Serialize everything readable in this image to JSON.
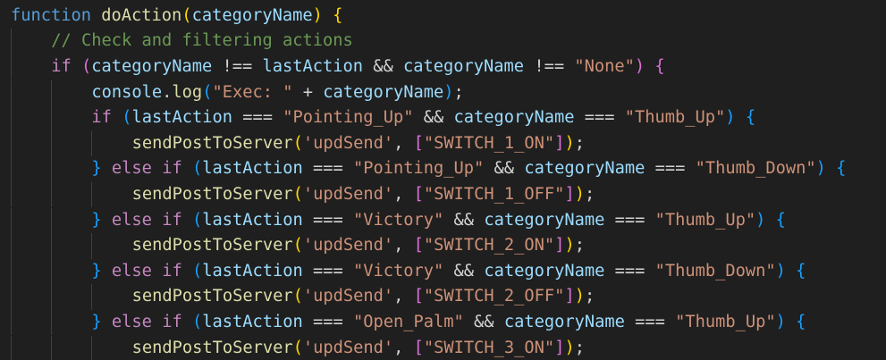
{
  "editor": {
    "colors": {
      "background": "#1f1f1f",
      "keyword": "#569cd6",
      "function": "#dcdcaa",
      "variable": "#9cdcfe",
      "comment": "#6a9955",
      "control": "#c586c0",
      "string": "#ce9178"
    },
    "lines": [
      {
        "indent": 0,
        "tokens": [
          [
            "function",
            "kw"
          ],
          [
            " ",
            "op"
          ],
          [
            "doAction",
            "fn"
          ],
          [
            "(",
            "b1"
          ],
          [
            "categoryName",
            "var"
          ],
          [
            ")",
            "b1"
          ],
          [
            " ",
            "op"
          ],
          [
            "{",
            "b1"
          ]
        ]
      },
      {
        "indent": 1,
        "tokens": [
          [
            "// Check and filtering actions",
            "cm"
          ]
        ]
      },
      {
        "indent": 1,
        "tokens": [
          [
            "if",
            "ctl"
          ],
          [
            " ",
            "op"
          ],
          [
            "(",
            "b2"
          ],
          [
            "categoryName",
            "var"
          ],
          [
            " !== ",
            "op"
          ],
          [
            "lastAction",
            "var"
          ],
          [
            " && ",
            "op"
          ],
          [
            "categoryName",
            "var"
          ],
          [
            " !== ",
            "op"
          ],
          [
            "\"None\"",
            "str"
          ],
          [
            ")",
            "b2"
          ],
          [
            " ",
            "op"
          ],
          [
            "{",
            "b2"
          ]
        ]
      },
      {
        "indent": 2,
        "tokens": [
          [
            "console",
            "var"
          ],
          [
            ".",
            "op"
          ],
          [
            "log",
            "fn"
          ],
          [
            "(",
            "b3"
          ],
          [
            "\"Exec: \"",
            "str"
          ],
          [
            " + ",
            "op"
          ],
          [
            "categoryName",
            "var"
          ],
          [
            ")",
            "b3"
          ],
          [
            ";",
            "op"
          ]
        ]
      },
      {
        "indent": 2,
        "tokens": [
          [
            "if",
            "ctl"
          ],
          [
            " ",
            "op"
          ],
          [
            "(",
            "b3"
          ],
          [
            "lastAction",
            "var"
          ],
          [
            " === ",
            "op"
          ],
          [
            "\"Pointing_Up\"",
            "str"
          ],
          [
            " && ",
            "op"
          ],
          [
            "categoryName",
            "var"
          ],
          [
            " === ",
            "op"
          ],
          [
            "\"Thumb_Up\"",
            "str"
          ],
          [
            ")",
            "b3"
          ],
          [
            " ",
            "op"
          ],
          [
            "{",
            "b3"
          ]
        ]
      },
      {
        "indent": 3,
        "tokens": [
          [
            "sendPostToServer",
            "fn"
          ],
          [
            "(",
            "b1"
          ],
          [
            "'updSend'",
            "str"
          ],
          [
            ", ",
            "op"
          ],
          [
            "[",
            "b2"
          ],
          [
            "\"SWITCH_1_ON\"",
            "str"
          ],
          [
            "]",
            "b2"
          ],
          [
            ")",
            "b1"
          ],
          [
            ";",
            "op"
          ]
        ]
      },
      {
        "indent": 2,
        "tokens": [
          [
            "}",
            "b3"
          ],
          [
            " ",
            "op"
          ],
          [
            "else",
            "ctl"
          ],
          [
            " ",
            "op"
          ],
          [
            "if",
            "ctl"
          ],
          [
            " ",
            "op"
          ],
          [
            "(",
            "b3"
          ],
          [
            "lastAction",
            "var"
          ],
          [
            " === ",
            "op"
          ],
          [
            "\"Pointing_Up\"",
            "str"
          ],
          [
            " && ",
            "op"
          ],
          [
            "categoryName",
            "var"
          ],
          [
            " === ",
            "op"
          ],
          [
            "\"Thumb_Down\"",
            "str"
          ],
          [
            ")",
            "b3"
          ],
          [
            " ",
            "op"
          ],
          [
            "{",
            "b3"
          ]
        ]
      },
      {
        "indent": 3,
        "tokens": [
          [
            "sendPostToServer",
            "fn"
          ],
          [
            "(",
            "b1"
          ],
          [
            "'updSend'",
            "str"
          ],
          [
            ", ",
            "op"
          ],
          [
            "[",
            "b2"
          ],
          [
            "\"SWITCH_1_OFF\"",
            "str"
          ],
          [
            "]",
            "b2"
          ],
          [
            ")",
            "b1"
          ],
          [
            ";",
            "op"
          ]
        ]
      },
      {
        "indent": 2,
        "tokens": [
          [
            "}",
            "b3"
          ],
          [
            " ",
            "op"
          ],
          [
            "else",
            "ctl"
          ],
          [
            " ",
            "op"
          ],
          [
            "if",
            "ctl"
          ],
          [
            " ",
            "op"
          ],
          [
            "(",
            "b3"
          ],
          [
            "lastAction",
            "var"
          ],
          [
            " === ",
            "op"
          ],
          [
            "\"Victory\"",
            "str"
          ],
          [
            " && ",
            "op"
          ],
          [
            "categoryName",
            "var"
          ],
          [
            " === ",
            "op"
          ],
          [
            "\"Thumb_Up\"",
            "str"
          ],
          [
            ")",
            "b3"
          ],
          [
            " ",
            "op"
          ],
          [
            "{",
            "b3"
          ]
        ]
      },
      {
        "indent": 3,
        "tokens": [
          [
            "sendPostToServer",
            "fn"
          ],
          [
            "(",
            "b1"
          ],
          [
            "'updSend'",
            "str"
          ],
          [
            ", ",
            "op"
          ],
          [
            "[",
            "b2"
          ],
          [
            "\"SWITCH_2_ON\"",
            "str"
          ],
          [
            "]",
            "b2"
          ],
          [
            ")",
            "b1"
          ],
          [
            ";",
            "op"
          ]
        ]
      },
      {
        "indent": 2,
        "tokens": [
          [
            "}",
            "b3"
          ],
          [
            " ",
            "op"
          ],
          [
            "else",
            "ctl"
          ],
          [
            " ",
            "op"
          ],
          [
            "if",
            "ctl"
          ],
          [
            " ",
            "op"
          ],
          [
            "(",
            "b3"
          ],
          [
            "lastAction",
            "var"
          ],
          [
            " === ",
            "op"
          ],
          [
            "\"Victory\"",
            "str"
          ],
          [
            " && ",
            "op"
          ],
          [
            "categoryName",
            "var"
          ],
          [
            " === ",
            "op"
          ],
          [
            "\"Thumb_Down\"",
            "str"
          ],
          [
            ")",
            "b3"
          ],
          [
            " ",
            "op"
          ],
          [
            "{",
            "b3"
          ]
        ]
      },
      {
        "indent": 3,
        "tokens": [
          [
            "sendPostToServer",
            "fn"
          ],
          [
            "(",
            "b1"
          ],
          [
            "'updSend'",
            "str"
          ],
          [
            ", ",
            "op"
          ],
          [
            "[",
            "b2"
          ],
          [
            "\"SWITCH_2_OFF\"",
            "str"
          ],
          [
            "]",
            "b2"
          ],
          [
            ")",
            "b1"
          ],
          [
            ";",
            "op"
          ]
        ]
      },
      {
        "indent": 2,
        "tokens": [
          [
            "}",
            "b3"
          ],
          [
            " ",
            "op"
          ],
          [
            "else",
            "ctl"
          ],
          [
            " ",
            "op"
          ],
          [
            "if",
            "ctl"
          ],
          [
            " ",
            "op"
          ],
          [
            "(",
            "b3"
          ],
          [
            "lastAction",
            "var"
          ],
          [
            " === ",
            "op"
          ],
          [
            "\"Open_Palm\"",
            "str"
          ],
          [
            " && ",
            "op"
          ],
          [
            "categoryName",
            "var"
          ],
          [
            " === ",
            "op"
          ],
          [
            "\"Thumb_Up\"",
            "str"
          ],
          [
            ")",
            "b3"
          ],
          [
            " ",
            "op"
          ],
          [
            "{",
            "b3"
          ]
        ]
      },
      {
        "indent": 3,
        "tokens": [
          [
            "sendPostToServer",
            "fn"
          ],
          [
            "(",
            "b1"
          ],
          [
            "'updSend'",
            "str"
          ],
          [
            ", ",
            "op"
          ],
          [
            "[",
            "b2"
          ],
          [
            "\"SWITCH_3_ON\"",
            "str"
          ],
          [
            "]",
            "b2"
          ],
          [
            ")",
            "b1"
          ],
          [
            ";",
            "op"
          ]
        ]
      }
    ]
  }
}
